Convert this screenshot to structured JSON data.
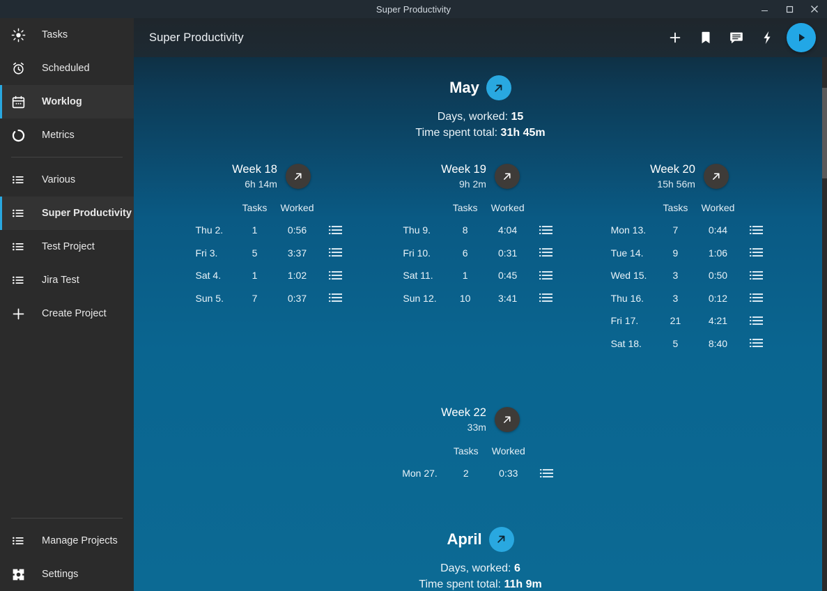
{
  "window": {
    "title": "Super Productivity",
    "controls": [
      {
        "name": "minimize",
        "glyph": "minimize-icon"
      },
      {
        "name": "maximize",
        "glyph": "maximize-icon"
      },
      {
        "name": "close",
        "glyph": "close-icon"
      }
    ]
  },
  "sidebar": {
    "items": [
      {
        "label": "Tasks",
        "icon": "sun-icon",
        "active": false
      },
      {
        "label": "Scheduled",
        "icon": "alarm-icon",
        "active": false
      },
      {
        "label": "Worklog",
        "icon": "calendar-icon",
        "active": true
      },
      {
        "label": "Metrics",
        "icon": "donut-icon",
        "active": false
      }
    ],
    "projects": [
      {
        "label": "Various",
        "icon": "list-icon",
        "active": false
      },
      {
        "label": "Super Productivity",
        "icon": "list-icon",
        "active": true
      },
      {
        "label": "Test Project",
        "icon": "list-icon",
        "active": false
      },
      {
        "label": "Jira Test",
        "icon": "list-icon",
        "active": false
      },
      {
        "label": "Create Project",
        "icon": "plus-icon",
        "active": false
      }
    ],
    "footer": [
      {
        "label": "Manage Projects",
        "icon": "list-icon"
      },
      {
        "label": "Settings",
        "icon": "gear-icon"
      }
    ]
  },
  "header": {
    "title": "Super Productivity",
    "buttons": [
      {
        "name": "add-task-button",
        "icon": "plus-icon"
      },
      {
        "name": "bookmarks-button",
        "icon": "bookmark-icon"
      },
      {
        "name": "notes-button",
        "icon": "comment-icon"
      },
      {
        "name": "quick-action-button",
        "icon": "bolt-icon"
      }
    ],
    "play_button": {
      "name": "play-button",
      "icon": "play-icon"
    }
  },
  "colors": {
    "accent": "#29a8e0",
    "sidebar_bg": "#2b2b2b",
    "main_bg_top": "#10242f",
    "main_bg_bottom": "#0c6a94",
    "week_button": "#3e3b38"
  },
  "table_headers": {
    "tasks": "Tasks",
    "worked": "Worked"
  },
  "labels": {
    "days_worked": "Days, worked:",
    "time_spent_total": "Time spent total:",
    "export_icon": "arrow-up-right-icon",
    "row_action_icon": "list-icon"
  },
  "months": [
    {
      "name": "May",
      "days_worked": "15",
      "time_spent_total": "31h 45m",
      "weeks": [
        {
          "title": "Week 18",
          "total": "6h 14m",
          "rows": [
            {
              "day": "Thu 2.",
              "tasks": "1",
              "worked": "0:56"
            },
            {
              "day": "Fri 3.",
              "tasks": "5",
              "worked": "3:37"
            },
            {
              "day": "Sat 4.",
              "tasks": "1",
              "worked": "1:02"
            },
            {
              "day": "Sun 5.",
              "tasks": "7",
              "worked": "0:37"
            }
          ]
        },
        {
          "title": "Week 19",
          "total": "9h 2m",
          "rows": [
            {
              "day": "Thu 9.",
              "tasks": "8",
              "worked": "4:04"
            },
            {
              "day": "Fri 10.",
              "tasks": "6",
              "worked": "0:31"
            },
            {
              "day": "Sat 11.",
              "tasks": "1",
              "worked": "0:45"
            },
            {
              "day": "Sun 12.",
              "tasks": "10",
              "worked": "3:41"
            }
          ]
        },
        {
          "title": "Week 20",
          "total": "15h 56m",
          "rows": [
            {
              "day": "Mon 13.",
              "tasks": "7",
              "worked": "0:44"
            },
            {
              "day": "Tue 14.",
              "tasks": "9",
              "worked": "1:06"
            },
            {
              "day": "Wed 15.",
              "tasks": "3",
              "worked": "0:50"
            },
            {
              "day": "Thu 16.",
              "tasks": "3",
              "worked": "0:12"
            },
            {
              "day": "Fri 17.",
              "tasks": "21",
              "worked": "4:21"
            },
            {
              "day": "Sat 18.",
              "tasks": "5",
              "worked": "8:40"
            }
          ]
        },
        {
          "title": "Week 22",
          "total": "33m",
          "rows": [
            {
              "day": "Mon 27.",
              "tasks": "2",
              "worked": "0:33"
            }
          ]
        }
      ]
    },
    {
      "name": "April",
      "days_worked": "6",
      "time_spent_total": "11h 9m",
      "weeks": []
    }
  ]
}
